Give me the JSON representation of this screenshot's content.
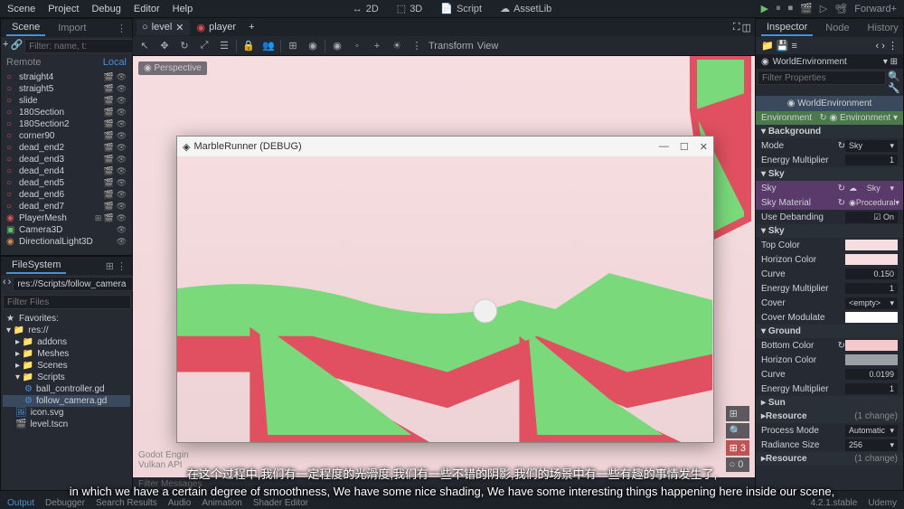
{
  "menu": {
    "scene": "Scene",
    "project": "Project",
    "debug": "Debug",
    "editor": "Editor",
    "help": "Help"
  },
  "top_center": {
    "mode2d": "2D",
    "mode3d": "3D",
    "script": "Script",
    "assetlib": "AssetLib"
  },
  "top_right": {
    "renderer": "Forward+"
  },
  "scene_panel": {
    "tab_scene": "Scene",
    "tab_import": "Import",
    "remote": "Remote",
    "local": "Local",
    "filter_placeholder": "Filter: name, t:",
    "nodes": [
      "straight4",
      "straight5",
      "slide",
      "180Section",
      "180Section2",
      "corner90",
      "dead_end2",
      "dead_end3",
      "dead_end4",
      "dead_end5",
      "dead_end6",
      "dead_end7",
      "PlayerMesh",
      "Camera3D",
      "DirectionalLight3D"
    ]
  },
  "filesystem": {
    "title": "FileSystem",
    "path": "res://Scripts/follow_camera",
    "filter_placeholder": "Filter Files",
    "favorites": "Favorites:",
    "root": "res://",
    "folders": [
      "addons",
      "Meshes",
      "Scenes",
      "Scripts"
    ],
    "files": [
      "ball_controller.gd",
      "follow_camera.gd",
      "icon.svg",
      "level.tscn"
    ]
  },
  "viewport": {
    "tab_level": "level",
    "tab_player": "player",
    "transform": "Transform",
    "view": "View",
    "perspective": "Perspective",
    "engine": "Godot Engin",
    "api": "Vulkan API",
    "filter_messages": "Filter Messages"
  },
  "debug_window": {
    "title": "MarbleRunner (DEBUG)"
  },
  "inspector": {
    "tab_inspector": "Inspector",
    "tab_node": "Node",
    "tab_history": "History",
    "node_name": "WorldEnvironment",
    "filter_placeholder": "Filter Properties",
    "class_name": "WorldEnvironment",
    "env_label": "Environment",
    "env_value": "Environment",
    "background": "Background",
    "mode": "Mode",
    "mode_value": "Sky",
    "energy_mult": "Energy Multiplier",
    "energy_mult_value": "1",
    "sky": "Sky",
    "sky_value": "Sky",
    "sky_material": "Sky Material",
    "sky_material_value": "Procedural",
    "use_debanding": "Use Debanding",
    "use_debanding_value": "On",
    "sky_sub": "Sky",
    "top_color": "Top Color",
    "horizon_color": "Horizon Color",
    "curve": "Curve",
    "curve_value": "0.150",
    "em2_value": "1",
    "cover": "Cover",
    "cover_value": "<empty>",
    "cover_modulate": "Cover Modulate",
    "ground": "Ground",
    "bottom_color": "Bottom Color",
    "horizon_color2": "Horizon Color",
    "curve2_value": "0.0199",
    "em3_value": "1",
    "sun": "Sun",
    "resource": "Resource",
    "resource_changes": "(1 change)",
    "process_mode": "Process Mode",
    "process_mode_value": "Automatic",
    "radiance_size": "Radiance Size",
    "radiance_size_value": "256"
  },
  "bottom": {
    "output": "Output",
    "debugger": "Debugger",
    "search": "Search Results",
    "audio": "Audio",
    "animation": "Animation",
    "shader": "Shader Editor",
    "version": "4.2.1.stable"
  },
  "subtitle1": "在这个过程中,我们有一定程度的光滑度,我们有一些不错的阴影,我们的场景中有一些有趣的事情发生了,",
  "subtitle2": "in which we have a certain degree of smoothness, We have some nice shading, We have some interesting things happening here inside our scene,",
  "udemy": "Udemy"
}
